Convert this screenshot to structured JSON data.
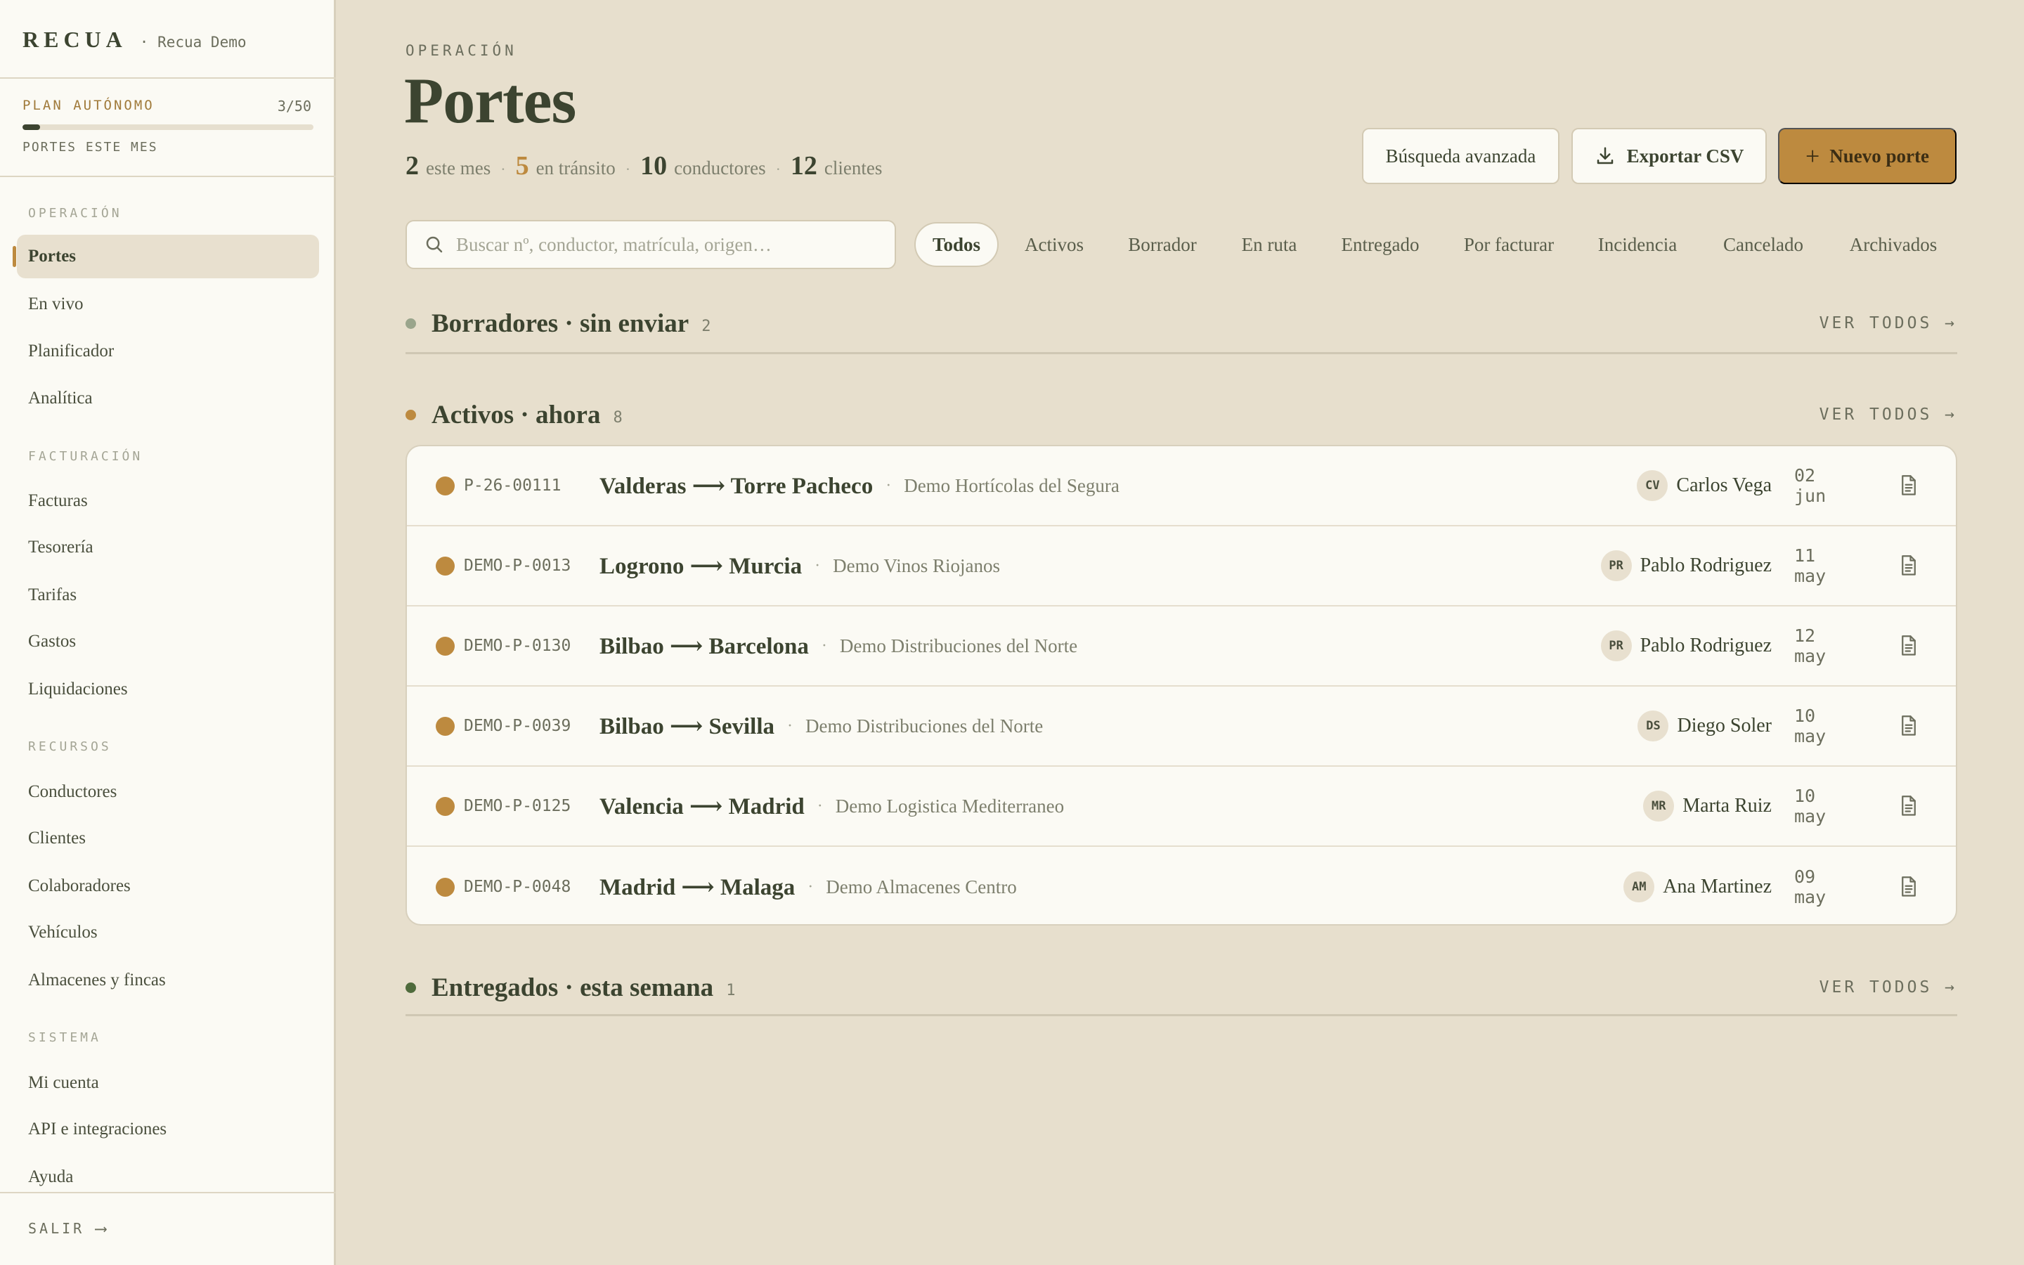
{
  "sidebar": {
    "brand": "RECUA",
    "workspace": "· Recua Demo",
    "plan": {
      "label": "PLAN AUTÓNOMO",
      "count": "3/50",
      "progress": 0.06,
      "caption": "PORTES ESTE MES"
    },
    "sections": [
      {
        "title": "OPERACIÓN",
        "items": [
          "Portes",
          "En vivo",
          "Planificador",
          "Analítica"
        ]
      },
      {
        "title": "FACTURACIÓN",
        "items": [
          "Facturas",
          "Tesorería",
          "Tarifas",
          "Gastos",
          "Liquidaciones"
        ]
      },
      {
        "title": "RECURSOS",
        "items": [
          "Conductores",
          "Clientes",
          "Colaboradores",
          "Vehículos",
          "Almacenes y fincas"
        ]
      },
      {
        "title": "SISTEMA",
        "items": [
          "Mi cuenta",
          "API e integraciones",
          "Ayuda"
        ]
      }
    ],
    "active_item": "Portes",
    "logout": "SALIR",
    "logout_arrow": "⟶"
  },
  "header": {
    "eyebrow": "OPERACIÓN",
    "title": "Portes",
    "stats": [
      {
        "value": "2",
        "label": "este mes"
      },
      {
        "value": "5",
        "label": "en tránsito"
      },
      {
        "value": "10",
        "label": "conductores"
      },
      {
        "value": "12",
        "label": "clientes"
      }
    ],
    "buttons": {
      "advanced_search": "Búsqueda avanzada",
      "export": "Exportar CSV",
      "new": "Nuevo porte",
      "new_plus": "+"
    }
  },
  "search": {
    "placeholder": "Buscar nº, conductor, matrícula, origen…",
    "value": ""
  },
  "filters": [
    "Todos",
    "Activos",
    "Borrador",
    "En ruta",
    "Entregado",
    "Por facturar",
    "Incidencia",
    "Cancelado",
    "Archivados"
  ],
  "active_filter": "Todos",
  "sections": {
    "drafts": {
      "title": "Borradores · sin enviar",
      "count": "2",
      "see_all": "VER TODOS →"
    },
    "active": {
      "title": "Activos · ahora",
      "count": "8",
      "see_all": "VER TODOS →"
    },
    "delivered": {
      "title": "Entregados · esta semana",
      "count": "1",
      "see_all": "VER TODOS →"
    }
  },
  "shipments": [
    {
      "code": "P-26-00111",
      "route": "Valderas ⟶ Torre Pacheco",
      "client": "Demo Hortícolas del Segura",
      "initials": "CV",
      "driver": "Carlos Vega",
      "date": "02 jun"
    },
    {
      "code": "DEMO-P-0013",
      "route": "Logrono ⟶ Murcia",
      "client": "Demo Vinos Riojanos",
      "initials": "PR",
      "driver": "Pablo Rodriguez",
      "date": "11 may"
    },
    {
      "code": "DEMO-P-0130",
      "route": "Bilbao ⟶ Barcelona",
      "client": "Demo Distribuciones del Norte",
      "initials": "PR",
      "driver": "Pablo Rodriguez",
      "date": "12 may"
    },
    {
      "code": "DEMO-P-0039",
      "route": "Bilbao ⟶ Sevilla",
      "client": "Demo Distribuciones del Norte",
      "initials": "DS",
      "driver": "Diego Soler",
      "date": "10 may"
    },
    {
      "code": "DEMO-P-0125",
      "route": "Valencia ⟶ Madrid",
      "client": "Demo Logistica Mediterraneo",
      "initials": "MR",
      "driver": "Marta Ruiz",
      "date": "10 may"
    },
    {
      "code": "DEMO-P-0048",
      "route": "Madrid ⟶ Malaga",
      "client": "Demo Almacenes Centro",
      "initials": "AM",
      "driver": "Ana Martinez",
      "date": "09 may"
    }
  ],
  "icons": {
    "search": "search-icon",
    "download": "download-icon",
    "document": "document-icon",
    "plus": "plus-icon"
  },
  "colors": {
    "accent": "#bd8a3f",
    "draft_dot": "#9aa58c",
    "active_dot": "#bd8a3f",
    "delivered_dot": "#4f6b3c",
    "ink": "#3c4430",
    "background": "#e7dfcd"
  }
}
